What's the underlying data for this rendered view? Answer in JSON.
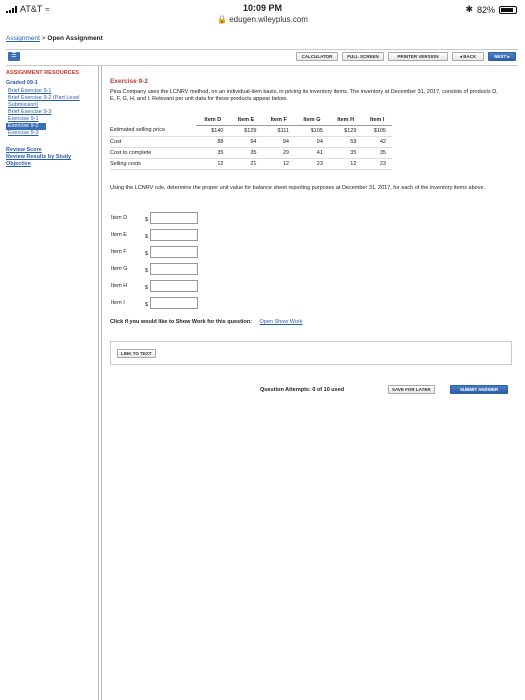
{
  "status": {
    "carrier": "AT&T",
    "time": "10:09 PM",
    "url": "edugen.wileyplus.com",
    "battery": "82%"
  },
  "breadcrumb": {
    "link": "Assignment",
    "separator": ">",
    "current": "Open Assignment"
  },
  "toolbar": {
    "calculator": "CALCULATOR",
    "full_screen": "FULL SCREEN",
    "printer_version": "PRINTER VERSION",
    "back": "◂ BACK",
    "next": "NEXT ▸"
  },
  "sidebar": {
    "heading": "ASSIGNMENT RESOURCES",
    "group": "Graded 09-1",
    "items": [
      "Brief Exercise 9-1",
      "Brief Exercise 9-2 (Part Level Submission)",
      "Brief Exercise 9-3",
      "Exercise 9-1",
      "Exercise 9-2",
      "Exercise 9-3"
    ],
    "review_score": "Review Score",
    "review_results": "Review Results by Study Objective"
  },
  "exercise": {
    "title": "Exercise 9-2",
    "description": "Pina Company uses the LCNRV method, on an individual-item basis, in pricing its inventory items. The inventory at December 31, 2017, consists of products D, E, F, G, H, and I. Relevant per unit data for these products appear below.",
    "columns": [
      "Item D",
      "Item E",
      "Item F",
      "Item G",
      "Item H",
      "Item I"
    ],
    "rows": [
      {
        "label": "Estimated selling price",
        "values": [
          "$140",
          "$129",
          "$111",
          "$105",
          "$129",
          "$105"
        ]
      },
      {
        "label": "Cost",
        "values": [
          "88",
          "94",
          "94",
          "94",
          "59",
          "42"
        ]
      },
      {
        "label": "Cost to complete",
        "values": [
          "35",
          "35",
          "29",
          "41",
          "35",
          "35"
        ]
      },
      {
        "label": "Selling costs",
        "values": [
          "12",
          "21",
          "12",
          "23",
          "12",
          "23"
        ]
      }
    ],
    "question": "Using the LCNRV rule, determine the proper unit value for balance sheet reporting purposes at December 31, 2017, for each of the inventory items above.",
    "answers": [
      {
        "label": "Item D",
        "currency": "$",
        "value": ""
      },
      {
        "label": "Item E",
        "currency": "$",
        "value": ""
      },
      {
        "label": "Item F",
        "currency": "$",
        "value": ""
      },
      {
        "label": "Item G",
        "currency": "$",
        "value": ""
      },
      {
        "label": "Item H",
        "currency": "$",
        "value": ""
      },
      {
        "label": "Item I",
        "currency": "$",
        "value": ""
      }
    ],
    "show_work_prompt": "Click if you would like to Show Work for this question:",
    "show_work_link": "Open Show Work",
    "link_to_text": "LINK TO TEXT"
  },
  "footer": {
    "attempts": "Question Attempts: 0 of 10 used",
    "save_later": "SAVE FOR LATER",
    "submit": "SUBMIT ANSWER"
  }
}
